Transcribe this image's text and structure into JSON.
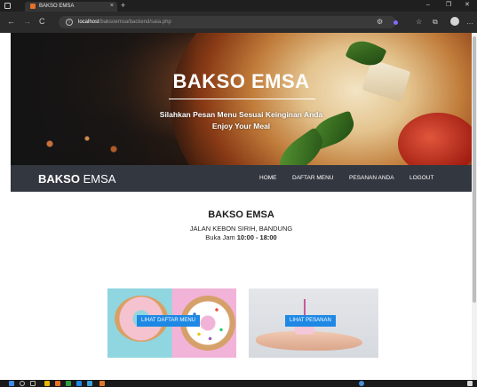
{
  "browser": {
    "tab_title": "BAKSO EMSA",
    "tab_close": "×",
    "new_tab": "+",
    "url_host": "localhost",
    "url_path": "/baksoemsa/backend/saia.php",
    "controls": {
      "minimize": "–",
      "maximize": "❐",
      "close": "✕"
    },
    "nav": {
      "back": "←",
      "forward": "→",
      "reload": "C"
    }
  },
  "hero": {
    "title": "BAKSO EMSA",
    "subtitle_line1": "Silahkan Pesan Menu Sesuai Keinginan Anda",
    "subtitle_line2": "Enjoy Your Meal"
  },
  "navbar": {
    "brand_bold": "BAKSO",
    "brand_rest": " EMSA",
    "items": [
      "HOME",
      "DAFTAR MENU",
      "PESANAN ANDA",
      "LOGOUT"
    ]
  },
  "shop": {
    "name": "BAKSO EMSA",
    "address": "JALAN KEBON SIRIH, BANDUNG",
    "hours_label": "Buka Jam ",
    "hours_value": "10:00 - 18:00"
  },
  "cards": {
    "menu_button": "LIHAT DAFTAR MENU",
    "order_button": "LIHAT PESANAN"
  },
  "colors": {
    "navbar": "#333740",
    "button": "#1e88e5"
  }
}
